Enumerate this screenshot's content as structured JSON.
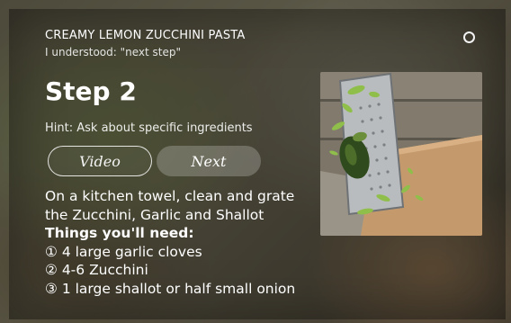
{
  "header": {
    "recipe_title": "CREAMY LEMON ZUCCHINI PASTA",
    "understood": "I understood: \"next step\""
  },
  "step": {
    "heading": "Step 2",
    "hint": "Hint: Ask about specific ingredients"
  },
  "buttons": {
    "video_label": "Video",
    "next_label": "Next"
  },
  "instructions": {
    "line1": "On a kitchen towel, clean and grate",
    "line2": "the Zucchini, Garlic and Shallot",
    "needs_heading": "Things you'll need:",
    "items": [
      "① 4 large garlic cloves",
      "② 4-6 Zucchini",
      "③ 1 large shallot or half small onion"
    ]
  },
  "icons": {
    "status_ring": "alexa-ring-icon"
  }
}
